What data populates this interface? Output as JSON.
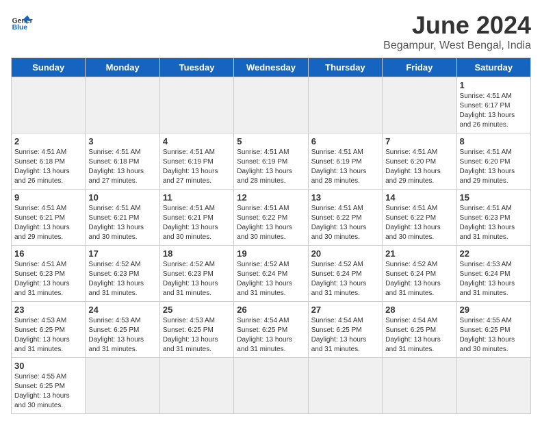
{
  "header": {
    "logo_general": "General",
    "logo_blue": "Blue",
    "month_title": "June 2024",
    "subtitle": "Begampur, West Bengal, India"
  },
  "days_of_week": [
    "Sunday",
    "Monday",
    "Tuesday",
    "Wednesday",
    "Thursday",
    "Friday",
    "Saturday"
  ],
  "weeks": [
    [
      {
        "day": "",
        "empty": true
      },
      {
        "day": "",
        "empty": true
      },
      {
        "day": "",
        "empty": true
      },
      {
        "day": "",
        "empty": true
      },
      {
        "day": "",
        "empty": true
      },
      {
        "day": "",
        "empty": true
      },
      {
        "day": "1",
        "sunrise": "Sunrise: 4:51 AM",
        "sunset": "Sunset: 6:17 PM",
        "daylight": "Daylight: 13 hours and 26 minutes."
      }
    ],
    [
      {
        "day": "2",
        "sunrise": "Sunrise: 4:51 AM",
        "sunset": "Sunset: 6:18 PM",
        "daylight": "Daylight: 13 hours and 26 minutes."
      },
      {
        "day": "3",
        "sunrise": "Sunrise: 4:51 AM",
        "sunset": "Sunset: 6:18 PM",
        "daylight": "Daylight: 13 hours and 27 minutes."
      },
      {
        "day": "4",
        "sunrise": "Sunrise: 4:51 AM",
        "sunset": "Sunset: 6:19 PM",
        "daylight": "Daylight: 13 hours and 27 minutes."
      },
      {
        "day": "5",
        "sunrise": "Sunrise: 4:51 AM",
        "sunset": "Sunset: 6:19 PM",
        "daylight": "Daylight: 13 hours and 28 minutes."
      },
      {
        "day": "6",
        "sunrise": "Sunrise: 4:51 AM",
        "sunset": "Sunset: 6:19 PM",
        "daylight": "Daylight: 13 hours and 28 minutes."
      },
      {
        "day": "7",
        "sunrise": "Sunrise: 4:51 AM",
        "sunset": "Sunset: 6:20 PM",
        "daylight": "Daylight: 13 hours and 29 minutes."
      },
      {
        "day": "8",
        "sunrise": "Sunrise: 4:51 AM",
        "sunset": "Sunset: 6:20 PM",
        "daylight": "Daylight: 13 hours and 29 minutes."
      }
    ],
    [
      {
        "day": "9",
        "sunrise": "Sunrise: 4:51 AM",
        "sunset": "Sunset: 6:21 PM",
        "daylight": "Daylight: 13 hours and 29 minutes."
      },
      {
        "day": "10",
        "sunrise": "Sunrise: 4:51 AM",
        "sunset": "Sunset: 6:21 PM",
        "daylight": "Daylight: 13 hours and 30 minutes."
      },
      {
        "day": "11",
        "sunrise": "Sunrise: 4:51 AM",
        "sunset": "Sunset: 6:21 PM",
        "daylight": "Daylight: 13 hours and 30 minutes."
      },
      {
        "day": "12",
        "sunrise": "Sunrise: 4:51 AM",
        "sunset": "Sunset: 6:22 PM",
        "daylight": "Daylight: 13 hours and 30 minutes."
      },
      {
        "day": "13",
        "sunrise": "Sunrise: 4:51 AM",
        "sunset": "Sunset: 6:22 PM",
        "daylight": "Daylight: 13 hours and 30 minutes."
      },
      {
        "day": "14",
        "sunrise": "Sunrise: 4:51 AM",
        "sunset": "Sunset: 6:22 PM",
        "daylight": "Daylight: 13 hours and 30 minutes."
      },
      {
        "day": "15",
        "sunrise": "Sunrise: 4:51 AM",
        "sunset": "Sunset: 6:23 PM",
        "daylight": "Daylight: 13 hours and 31 minutes."
      }
    ],
    [
      {
        "day": "16",
        "sunrise": "Sunrise: 4:51 AM",
        "sunset": "Sunset: 6:23 PM",
        "daylight": "Daylight: 13 hours and 31 minutes."
      },
      {
        "day": "17",
        "sunrise": "Sunrise: 4:52 AM",
        "sunset": "Sunset: 6:23 PM",
        "daylight": "Daylight: 13 hours and 31 minutes."
      },
      {
        "day": "18",
        "sunrise": "Sunrise: 4:52 AM",
        "sunset": "Sunset: 6:23 PM",
        "daylight": "Daylight: 13 hours and 31 minutes."
      },
      {
        "day": "19",
        "sunrise": "Sunrise: 4:52 AM",
        "sunset": "Sunset: 6:24 PM",
        "daylight": "Daylight: 13 hours and 31 minutes."
      },
      {
        "day": "20",
        "sunrise": "Sunrise: 4:52 AM",
        "sunset": "Sunset: 6:24 PM",
        "daylight": "Daylight: 13 hours and 31 minutes."
      },
      {
        "day": "21",
        "sunrise": "Sunrise: 4:52 AM",
        "sunset": "Sunset: 6:24 PM",
        "daylight": "Daylight: 13 hours and 31 minutes."
      },
      {
        "day": "22",
        "sunrise": "Sunrise: 4:53 AM",
        "sunset": "Sunset: 6:24 PM",
        "daylight": "Daylight: 13 hours and 31 minutes."
      }
    ],
    [
      {
        "day": "23",
        "sunrise": "Sunrise: 4:53 AM",
        "sunset": "Sunset: 6:25 PM",
        "daylight": "Daylight: 13 hours and 31 minutes."
      },
      {
        "day": "24",
        "sunrise": "Sunrise: 4:53 AM",
        "sunset": "Sunset: 6:25 PM",
        "daylight": "Daylight: 13 hours and 31 minutes."
      },
      {
        "day": "25",
        "sunrise": "Sunrise: 4:53 AM",
        "sunset": "Sunset: 6:25 PM",
        "daylight": "Daylight: 13 hours and 31 minutes."
      },
      {
        "day": "26",
        "sunrise": "Sunrise: 4:54 AM",
        "sunset": "Sunset: 6:25 PM",
        "daylight": "Daylight: 13 hours and 31 minutes."
      },
      {
        "day": "27",
        "sunrise": "Sunrise: 4:54 AM",
        "sunset": "Sunset: 6:25 PM",
        "daylight": "Daylight: 13 hours and 31 minutes."
      },
      {
        "day": "28",
        "sunrise": "Sunrise: 4:54 AM",
        "sunset": "Sunset: 6:25 PM",
        "daylight": "Daylight: 13 hours and 31 minutes."
      },
      {
        "day": "29",
        "sunrise": "Sunrise: 4:55 AM",
        "sunset": "Sunset: 6:25 PM",
        "daylight": "Daylight: 13 hours and 30 minutes."
      }
    ],
    [
      {
        "day": "30",
        "sunrise": "Sunrise: 4:55 AM",
        "sunset": "Sunset: 6:25 PM",
        "daylight": "Daylight: 13 hours and 30 minutes."
      },
      {
        "day": "",
        "empty": true
      },
      {
        "day": "",
        "empty": true
      },
      {
        "day": "",
        "empty": true
      },
      {
        "day": "",
        "empty": true
      },
      {
        "day": "",
        "empty": true
      },
      {
        "day": "",
        "empty": true
      }
    ]
  ]
}
